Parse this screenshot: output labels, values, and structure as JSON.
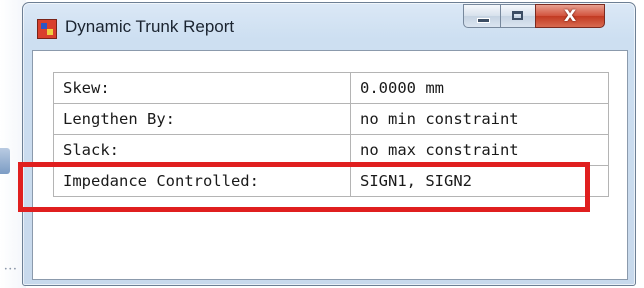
{
  "window": {
    "title": "Dynamic Trunk Report",
    "icon": "app-icon"
  },
  "controls": {
    "minimize": "minimize-icon",
    "maximize": "maximize-icon",
    "close_label": "X"
  },
  "report": {
    "rows": [
      {
        "label": "Skew:",
        "value": "0.0000 mm"
      },
      {
        "label": "Lengthen By:",
        "value": "no min constraint"
      },
      {
        "label": "Slack:",
        "value": "no max constraint"
      },
      {
        "label": "Impedance Controlled:",
        "value": "SIGN1, SIGN2"
      }
    ]
  },
  "colors": {
    "highlight": "#e01f1f",
    "close_button": "#c23a22"
  }
}
